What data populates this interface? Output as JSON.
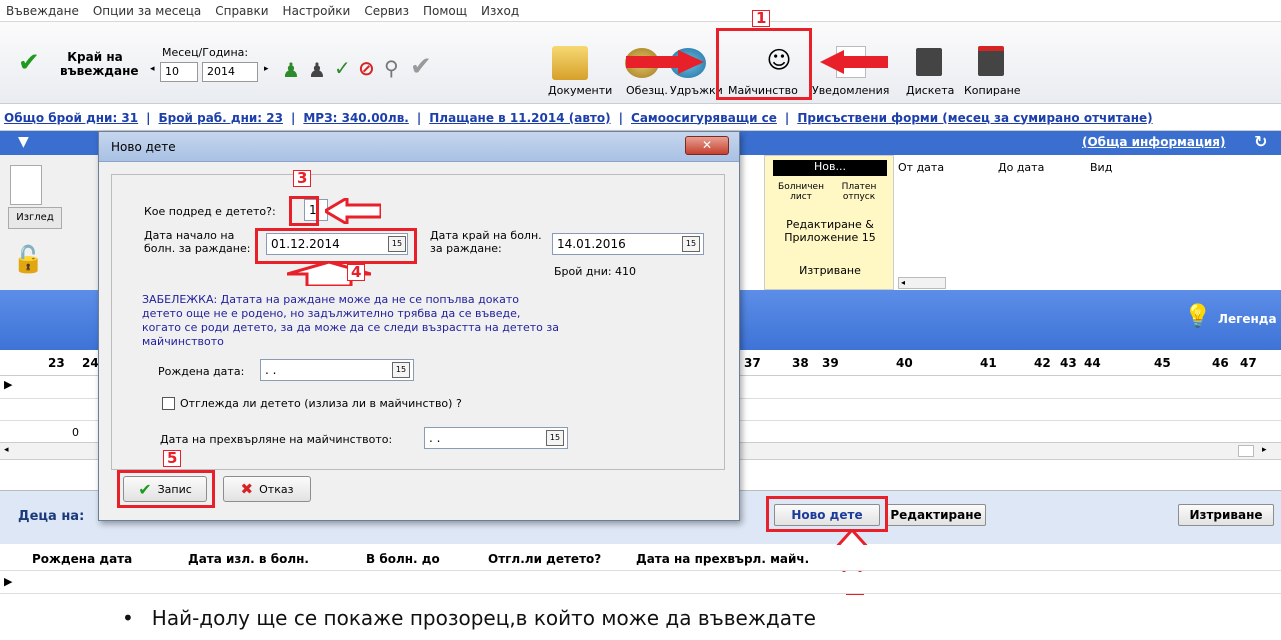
{
  "menu": [
    "Въвеждане",
    "Опции за месеца",
    "Справки",
    "Настройки",
    "Сервиз",
    "Помощ",
    "Изход"
  ],
  "toolbar": {
    "end_entry": "Край на въвеждане",
    "month_year_label": "Месец/Година:",
    "month": "10",
    "year": "2014",
    "buttons": [
      "Документи",
      "Обезщ.",
      "Удръжки",
      "Майчинство",
      "Уведомления",
      "Дискета",
      "Копиране"
    ]
  },
  "infobar": [
    "Общо брой дни: 31",
    "Брой раб. дни: 23",
    "МРЗ: 340.00лв.",
    "Плащане в 11.2014 (авто)",
    "Самоосигуряващи се",
    "Присъствени форми (месец за сумирано отчитане)"
  ],
  "general_info": "(Обща информация)",
  "side": {
    "view_button": "Изглед"
  },
  "right_panel": {
    "new": "Нов...",
    "sick_leave": "Болничен лист",
    "paid_leave": "Платен отпуск",
    "edit": "Редактиране & Приложение 15",
    "delete": "Изтриване",
    "col_from": "От дата",
    "col_to": "До дата",
    "col_type": "Вид"
  },
  "legend": "Легенда",
  "grid_days": [
    "23",
    "24",
    "37",
    "38",
    "39",
    "40",
    "41",
    "42",
    "43",
    "44",
    "45",
    "46",
    "47"
  ],
  "grid_value": "0",
  "dialog": {
    "title": "Ново дете",
    "child_order_label": "Кое подред е детето?:",
    "child_order_value": "1",
    "start_label": "Дата начало на болн. за раждане:",
    "start_value": "01.12.2014",
    "end_label": "Дата край на болн. за раждане:",
    "end_value": "14.01.2016",
    "days_count": "Брой дни: 410",
    "note": "ЗАБЕЛЕЖКА: Датата на раждане може да не се попълва докато детето още не е родено, но задължително трябва да се въведе, когато се роди детето, за да може да се следи възрастта на детето за майчинството",
    "birth_label": "Рождена дата:",
    "birth_value": " . .",
    "care_checkbox": "Отглежда ли детето (излиза ли в майчинство) ?",
    "transfer_label": "Дата на прехвърляне на майчинството:",
    "transfer_value": " . .",
    "save": "Запис",
    "cancel": "Отказ"
  },
  "children": {
    "label": "Деца на:",
    "new_child": "Ново дете",
    "edit": "Редактиране",
    "delete": "Изтриване",
    "columns": [
      "Рождена дата",
      "Дата изл. в болн.",
      "В болн. до",
      "Отгл.ли детето?",
      "Дата на прехвърл. майч."
    ]
  },
  "annotations": [
    "1",
    "2",
    "3",
    "4",
    "5"
  ],
  "caption": "Най-долу ще се покаже прозорец,в който може да въвеждате"
}
